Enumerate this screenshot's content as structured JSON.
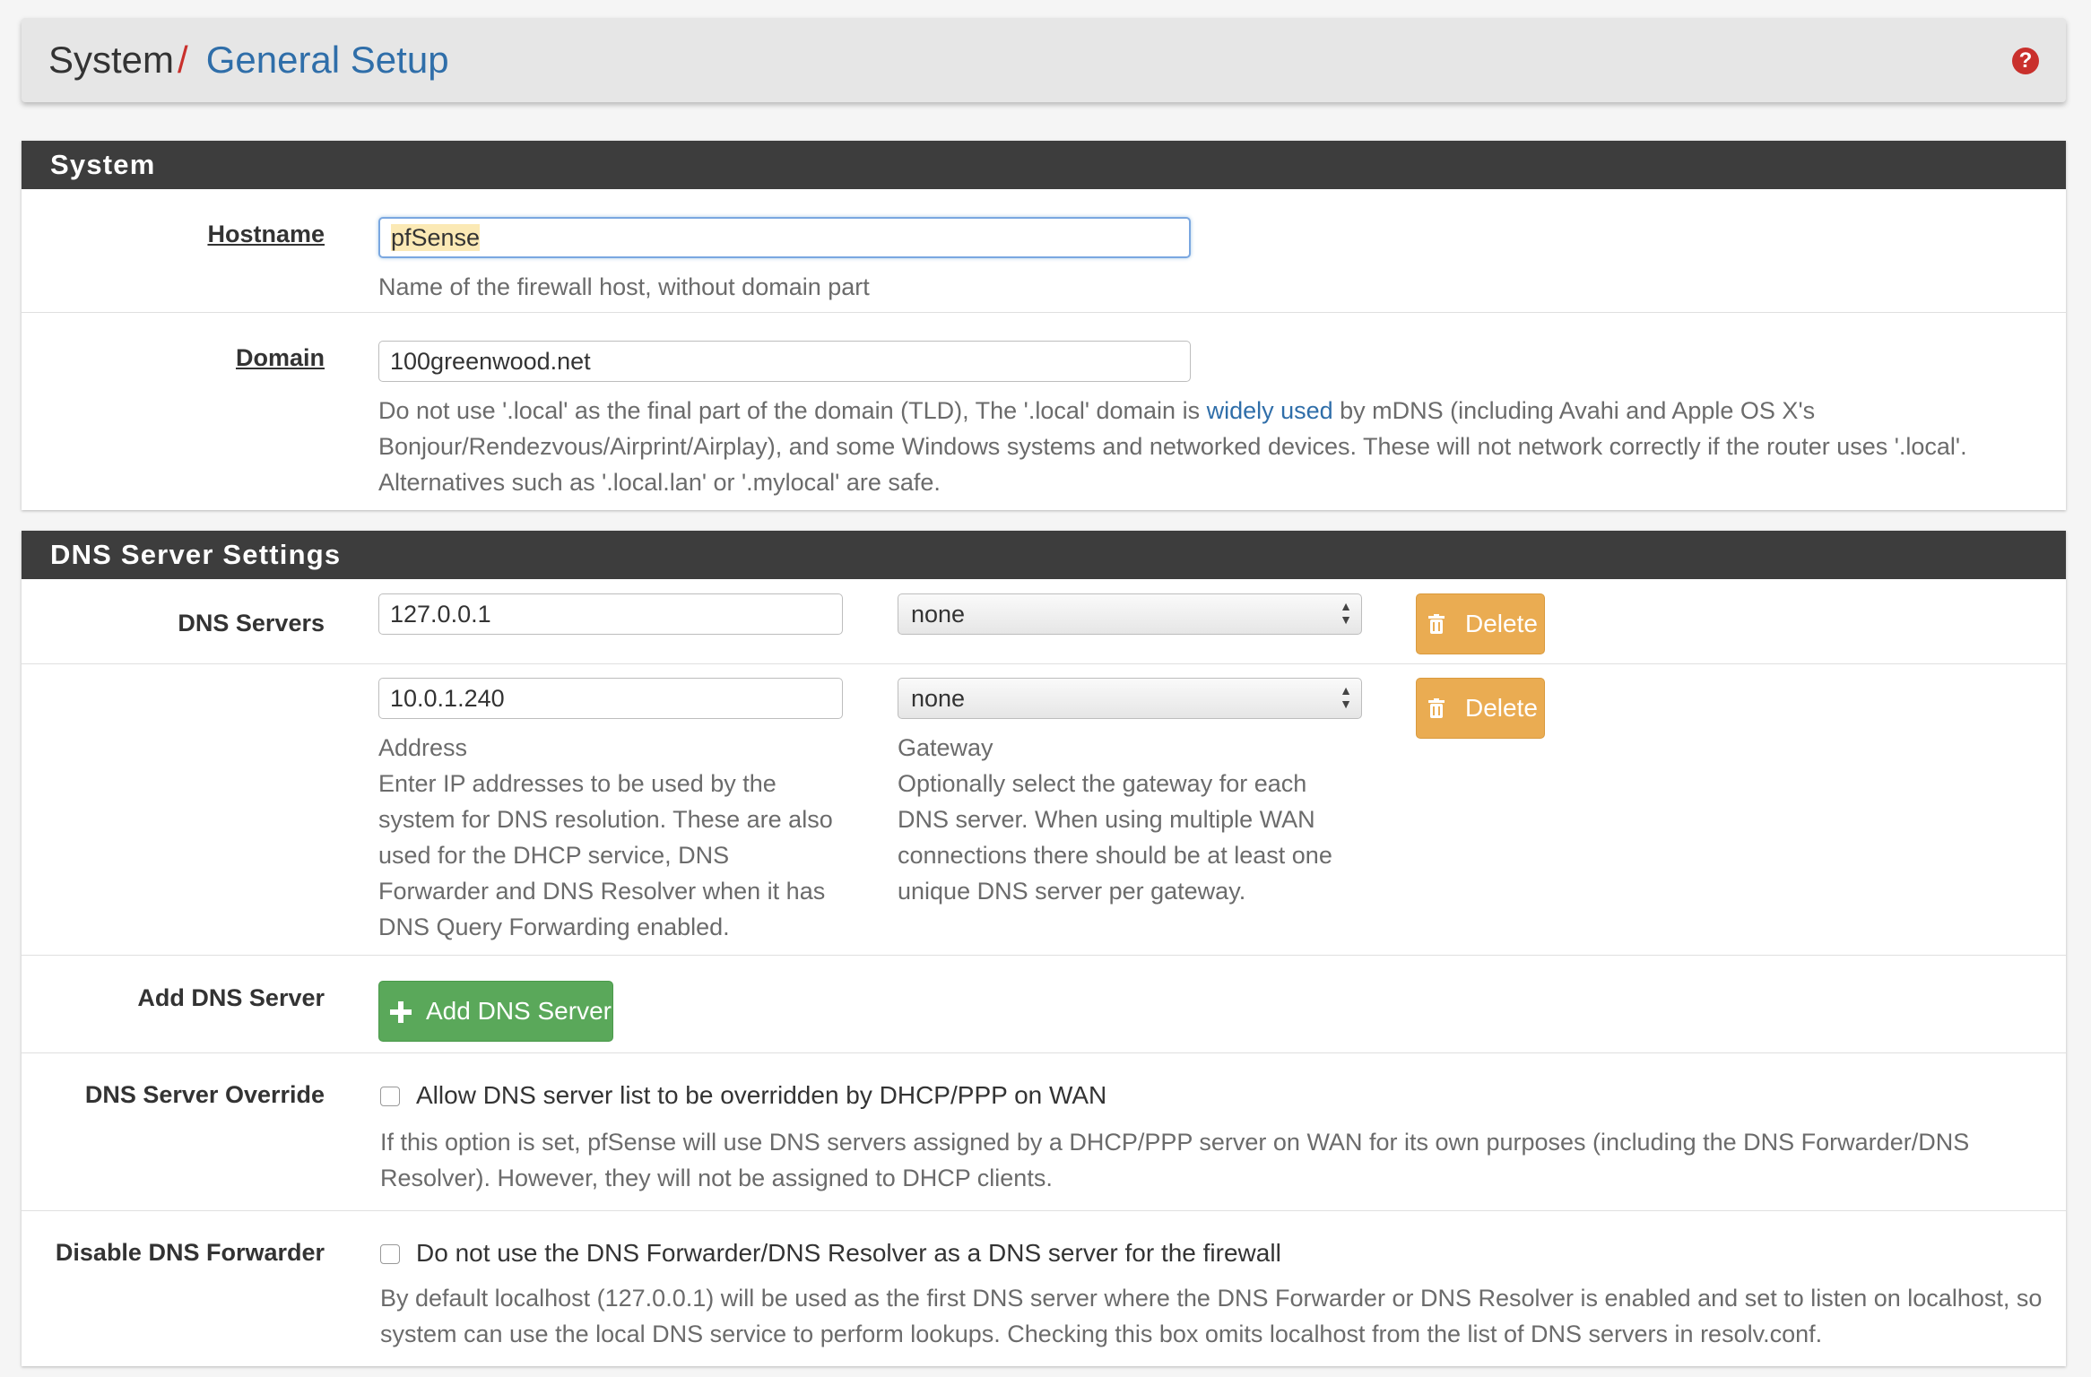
{
  "breadcrumb": {
    "root": "System",
    "separator": "/",
    "current": "General Setup"
  },
  "help_icon": "question-icon",
  "system_panel": {
    "title": "System",
    "hostname": {
      "label": "Hostname",
      "value": "pfSense",
      "help": "Name of the firewall host, without domain part"
    },
    "domain": {
      "label": "Domain",
      "value": "100greenwood.net",
      "help_pre": "Do not use '.local' as the final part of the domain (TLD), The '.local' domain is ",
      "help_link": "widely used",
      "help_post": " by mDNS (including Avahi and Apple OS X's Bonjour/Rendezvous/Airprint/Airplay), and some Windows systems and networked devices. These will not network correctly if the router uses '.local'. Alternatives such as '.local.lan' or '.mylocal' are safe."
    }
  },
  "dns_panel": {
    "title": "DNS Server Settings",
    "servers_label": "DNS Servers",
    "servers": [
      {
        "address": "127.0.0.1",
        "gateway": "none",
        "delete_label": "Delete"
      },
      {
        "address": "10.0.1.240",
        "gateway": "none",
        "delete_label": "Delete"
      }
    ],
    "address_title": "Address",
    "address_help": "Enter IP addresses to be used by the system for DNS resolution. These are also used for the DHCP service, DNS Forwarder and DNS Resolver when it has DNS Query Forwarding enabled.",
    "gateway_title": "Gateway",
    "gateway_help": "Optionally select the gateway for each DNS server. When using multiple WAN connections there should be at least one unique DNS server per gateway.",
    "add": {
      "label": "Add DNS Server",
      "button_label": "Add DNS Server"
    },
    "override": {
      "label": "DNS Server Override",
      "checkbox_label": "Allow DNS server list to be overridden by DHCP/PPP on WAN",
      "checked": false,
      "help": "If this option is set, pfSense will use DNS servers assigned by a DHCP/PPP server on WAN for its own purposes (including the DNS Forwarder/DNS Resolver). However, they will not be assigned to DHCP clients."
    },
    "disable_forwarder": {
      "label": "Disable DNS Forwarder",
      "checkbox_label": "Do not use the DNS Forwarder/DNS Resolver as a DNS server for the firewall",
      "checked": false,
      "help": "By default localhost (127.0.0.1) will be used as the first DNS server where the DNS Forwarder or DNS Resolver is enabled and set to listen on localhost, so system can use the local DNS service to perform lookups. Checking this box omits localhost from the list of DNS servers in resolv.conf."
    }
  },
  "colors": {
    "accent": "#2f6ea9",
    "danger": "#c9302c",
    "warning": "#eaac52",
    "success": "#5aa85a",
    "panel_heading": "#3d3d3d"
  }
}
